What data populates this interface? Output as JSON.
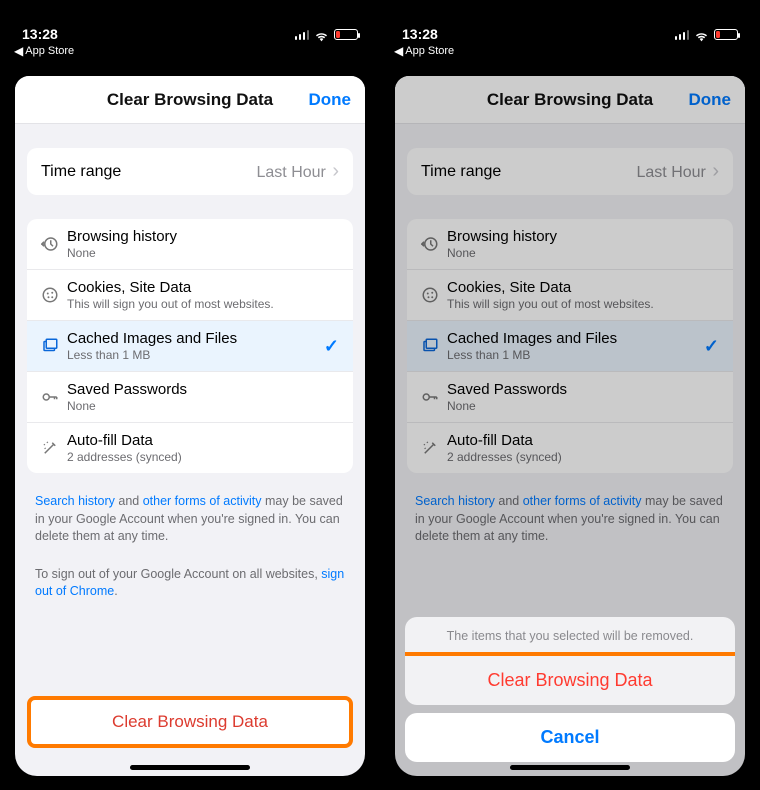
{
  "status": {
    "time": "13:28",
    "back_app": "App Store"
  },
  "modal": {
    "title": "Clear Browsing Data",
    "done": "Done"
  },
  "timerange": {
    "label": "Time range",
    "value": "Last Hour"
  },
  "items": [
    {
      "title": "Browsing history",
      "sub": "None",
      "icon": "history-icon",
      "selected": false
    },
    {
      "title": "Cookies, Site Data",
      "sub": "This will sign you out of most websites.",
      "icon": "cookie-icon",
      "selected": false
    },
    {
      "title": "Cached Images and Files",
      "sub": "Less than 1 MB",
      "icon": "images-icon",
      "selected": true
    },
    {
      "title": "Saved Passwords",
      "sub": "None",
      "icon": "key-icon",
      "selected": false
    },
    {
      "title": "Auto-fill Data",
      "sub": "2 addresses (synced)",
      "icon": "wand-icon",
      "selected": false
    }
  ],
  "note1": {
    "link1": "Search history",
    "mid1": " and ",
    "link2": "other forms of activity",
    "rest": " may be saved in your Google Account when you're signed in. You can delete them at any time."
  },
  "note2": {
    "pre": "To sign out of your Google Account on all websites, ",
    "link": "sign out of Chrome",
    "post": "."
  },
  "cta": {
    "label": "Clear Browsing Data"
  },
  "sheet2": {
    "message": "The items that you selected will be removed.",
    "destructive": "Clear Browsing Data",
    "cancel": "Cancel"
  }
}
